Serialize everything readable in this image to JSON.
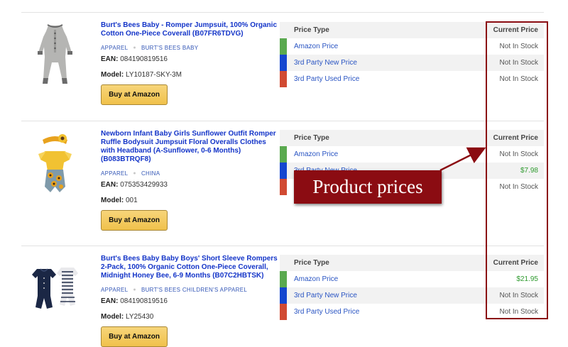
{
  "price_table_headers": {
    "type": "Price Type",
    "current": "Current Price"
  },
  "buy_label": "Buy at Amazon",
  "labels": {
    "ean": "EAN:",
    "model": "Model:"
  },
  "price_colors": {
    "amazon": "#5aa94f",
    "new": "#1446cf",
    "used": "#d14a32"
  },
  "products": [
    {
      "title": "Burt's Bees Baby - Romper Jumpsuit, 100% Organic Cotton One-Piece Coverall (B07FR6TDVG)",
      "category": "APPAREL",
      "brand": "BURT'S BEES BABY",
      "ean": "084190819516",
      "model": "LY10187-SKY-3M",
      "image": "gray-romper",
      "prices": [
        {
          "type": "Amazon Price",
          "value": "Not In Stock"
        },
        {
          "type": "3rd Party New Price",
          "value": "Not In Stock"
        },
        {
          "type": "3rd Party Used Price",
          "value": "Not In Stock"
        }
      ]
    },
    {
      "title": "Newborn Infant Baby Girls Sunflower Outfit Romper Ruffle Bodysuit Jumpsuit Floral Overalls Clothes with Headband (A-Sunflower, 0-6 Months) (B083BTRQF8)",
      "category": "APPAREL",
      "brand": "CHINA",
      "ean": "075353429933",
      "model": "001",
      "image": "sunflower-romper",
      "prices": [
        {
          "type": "Amazon Price",
          "value": "Not In Stock"
        },
        {
          "type": "3rd Party New Price",
          "value": "$7.98"
        },
        {
          "type": "3rd Party Used Price",
          "value": "Not In Stock"
        }
      ]
    },
    {
      "title": "Burt's Bees Baby Baby Boys' Short Sleeve Rompers 2-Pack, 100% Organic Cotton One-Piece Coverall, Midnight Honey Bee, 6-9 Months (B07C2HBTSK)",
      "category": "APPAREL",
      "brand": "BURT'S BEES CHILDREN'S APPAREL",
      "ean": "084190819516",
      "model": "LY25430",
      "image": "navy-striped-rompers",
      "prices": [
        {
          "type": "Amazon Price",
          "value": "$21.95"
        },
        {
          "type": "3rd Party New Price",
          "value": "Not In Stock"
        },
        {
          "type": "3rd Party Used Price",
          "value": "Not In Stock"
        }
      ]
    }
  ],
  "annotation": {
    "label": "Product prices",
    "color": "#8b0c12"
  }
}
